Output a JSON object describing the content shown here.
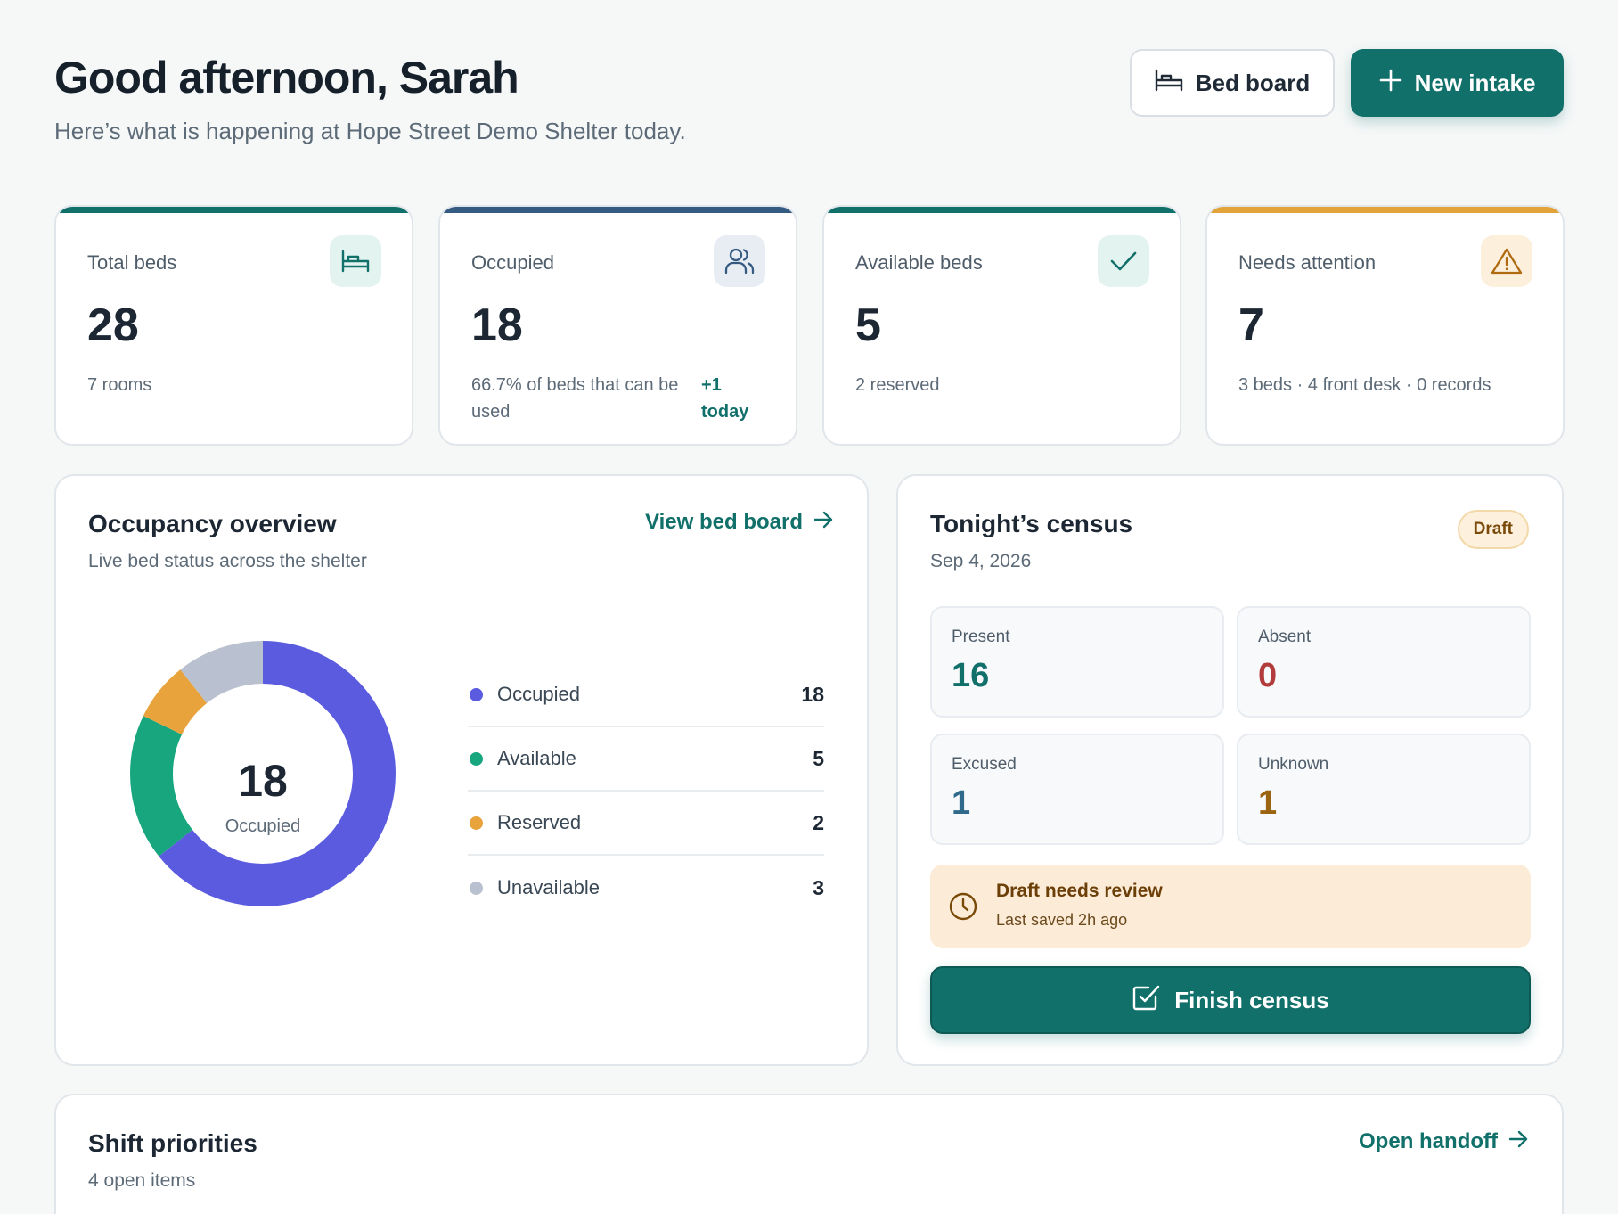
{
  "header": {
    "greeting": "Good afternoon, Sarah",
    "subtitle": "Here’s what is happening at Hope Street Demo Shelter today.",
    "bed_board_label": "Bed board",
    "new_intake_label": "New intake"
  },
  "stats": [
    {
      "label": "Total beds",
      "value": "28",
      "note": "7 rooms",
      "accent": "#12706b",
      "icon": "bed-icon"
    },
    {
      "label": "Occupied",
      "value": "18",
      "note": "66.7% of beds that can be used",
      "delta": "+1 today",
      "accent": "#355b82",
      "icon": "people-icon"
    },
    {
      "label": "Available beds",
      "value": "5",
      "note": "2 reserved",
      "accent": "#12706b",
      "icon": "check-icon"
    },
    {
      "label": "Needs attention",
      "value": "7",
      "note": "3 beds · 4 front desk · 0 records",
      "accent": "#e3a33b",
      "icon": "warning-icon"
    }
  ],
  "occupancy": {
    "title": "Occupancy overview",
    "subtitle": "Live bed status across the shelter",
    "link_label": "View bed board",
    "center_value": "18",
    "center_label": "Occupied",
    "legend": [
      {
        "label": "Occupied",
        "value": 18,
        "color": "#5b5be0"
      },
      {
        "label": "Available",
        "value": 5,
        "color": "#17a67e"
      },
      {
        "label": "Reserved",
        "value": 2,
        "color": "#e8a33c"
      },
      {
        "label": "Unavailable",
        "value": 3,
        "color": "#b9c0cf"
      }
    ]
  },
  "census": {
    "title": "Tonight’s census",
    "date": "Sep 4, 2026",
    "badge": "Draft",
    "cells": [
      {
        "label": "Present",
        "value": "16",
        "color": "#12706b"
      },
      {
        "label": "Absent",
        "value": "0",
        "color": "#b23b3b"
      },
      {
        "label": "Excused",
        "value": "1",
        "color": "#2f6a8a"
      },
      {
        "label": "Unknown",
        "value": "1",
        "color": "#9a6410"
      }
    ],
    "review_title": "Draft needs review",
    "review_note": "Last saved 2h ago",
    "finish_label": "Finish census"
  },
  "priorities": {
    "title": "Shift priorities",
    "subtitle": "4 open items",
    "link_label": "Open handoff"
  }
}
